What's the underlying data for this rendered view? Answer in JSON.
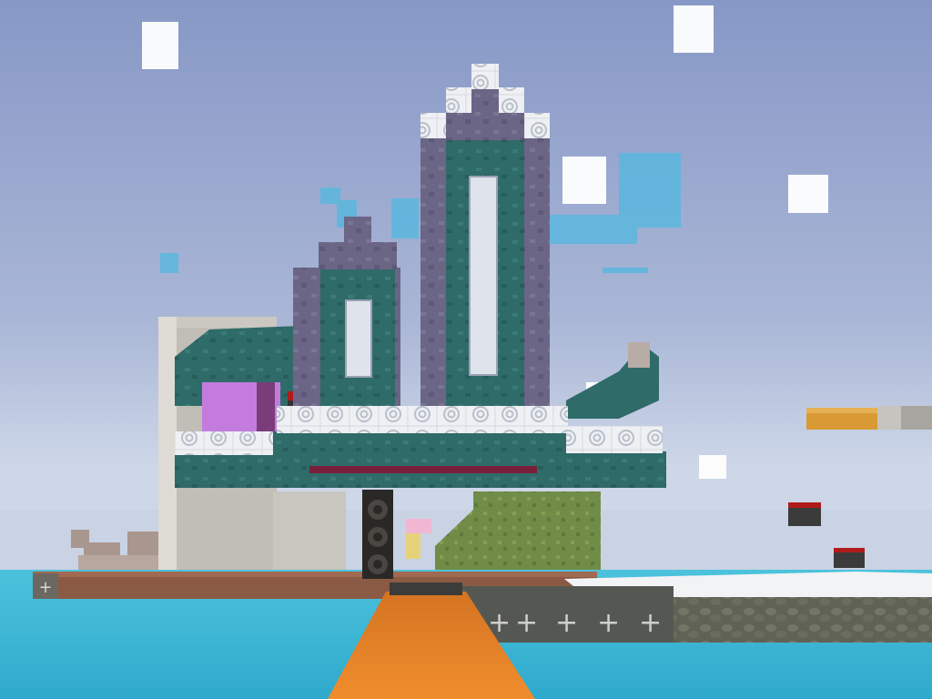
{
  "scene": {
    "type": "voxel-sandbox-world",
    "sky_color": "#8fa0c8",
    "horizon_color": "#c9d4e6",
    "water_color": "#3fb8d6",
    "path_color": "#e8872a",
    "hud_visible": false
  },
  "structures": [
    {
      "id": "central-spire-tower",
      "icon": "spire-building"
    },
    {
      "id": "floating-disc-platform",
      "icon": "disc-platform"
    },
    {
      "id": "pillar",
      "icon": "speaker-column"
    },
    {
      "id": "gray-tower",
      "icon": "stone-tower"
    },
    {
      "id": "floating-island-right",
      "icon": "floating-block"
    }
  ],
  "palette": {
    "purple_block": "#6d6687",
    "teal_block": "#2f6b68",
    "white_block": "#f0f1f4",
    "glass": "#d8dde8",
    "stone": "#c8c4be",
    "grass": "#6f8a45",
    "dirt": "#8a5a44"
  }
}
